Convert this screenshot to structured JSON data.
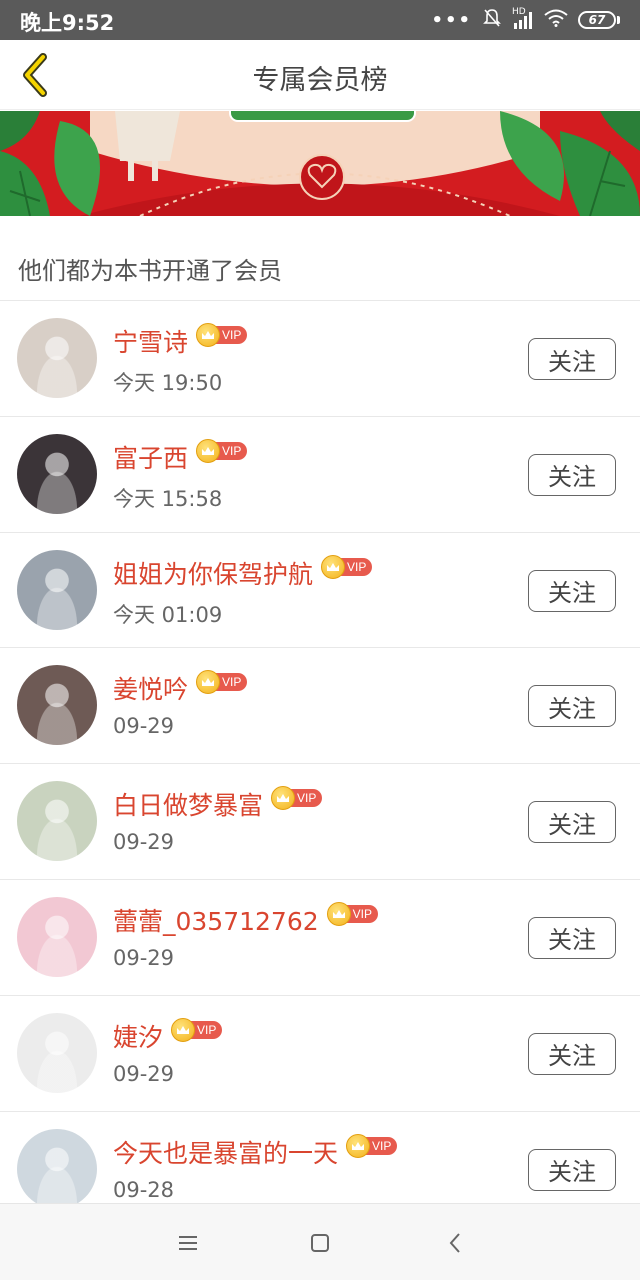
{
  "status_bar": {
    "time": "晚上9:52",
    "signal_label": "HD",
    "battery": "67"
  },
  "header": {
    "title": "专属会员榜"
  },
  "section": {
    "heading": "他们都为本书开通了会员"
  },
  "follow_label": "关注",
  "vip_label": "VIP",
  "members": [
    {
      "name": "宁雪诗",
      "time": "今天 19:50",
      "avatar_color": "#d8cfc7"
    },
    {
      "name": "富子西",
      "time": "今天 15:58",
      "avatar_color": "#3b3438"
    },
    {
      "name": "姐姐为你保驾护航",
      "time": "今天 01:09",
      "avatar_color": "#9aa3ad"
    },
    {
      "name": "姜悦吟",
      "time": "09-29",
      "avatar_color": "#6e5a55"
    },
    {
      "name": "白日做梦暴富",
      "time": "09-29",
      "avatar_color": "#c9d3bf"
    },
    {
      "name": "蕾蕾_035712762",
      "time": "09-29",
      "avatar_color": "#f2c8d3"
    },
    {
      "name": "婕汐",
      "time": "09-29",
      "avatar_color": "#ececec"
    },
    {
      "name": "今天也是暴富的一天",
      "time": "09-28",
      "avatar_color": "#cfd8df"
    }
  ],
  "colors": {
    "name_text": "#d9452f",
    "vip_tag": "#e75a4d",
    "banner": "#d31c20",
    "back_arrow": "#e3c200"
  },
  "icons": {
    "back": "chevron-left-icon",
    "menu": "menu-icon",
    "home": "square-home-icon",
    "nav_back": "chevron-left-icon"
  }
}
